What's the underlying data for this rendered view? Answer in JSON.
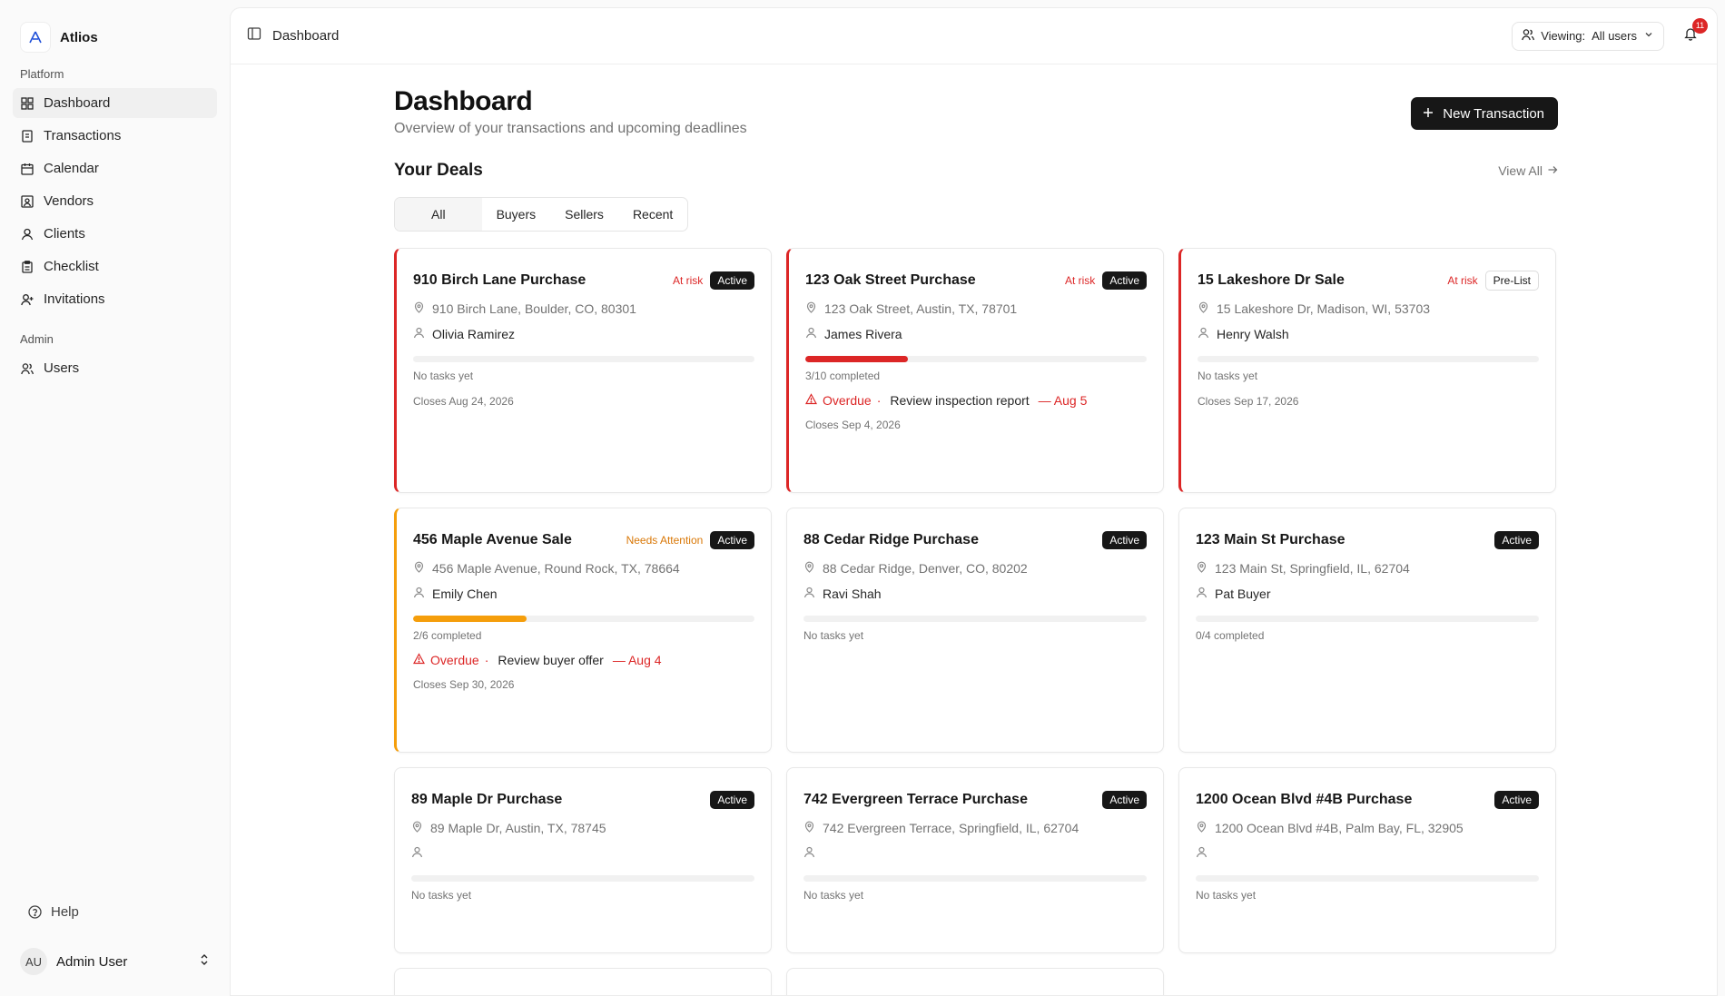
{
  "brand": {
    "name": "Atlios"
  },
  "sidebar": {
    "platform_label": "Platform",
    "items": [
      {
        "label": "Dashboard",
        "icon": "grid-icon"
      },
      {
        "label": "Transactions",
        "icon": "receipt-icon"
      },
      {
        "label": "Calendar",
        "icon": "calendar-icon"
      },
      {
        "label": "Vendors",
        "icon": "vendor-icon"
      },
      {
        "label": "Clients",
        "icon": "user-icon"
      },
      {
        "label": "Checklist",
        "icon": "clipboard-icon"
      },
      {
        "label": "Invitations",
        "icon": "user-plus-icon"
      }
    ],
    "admin_label": "Admin",
    "admin_items": [
      {
        "label": "Users",
        "icon": "users-icon"
      }
    ],
    "help_label": "Help",
    "user": {
      "initials": "AU",
      "name": "Admin User"
    }
  },
  "topbar": {
    "breadcrumb": "Dashboard",
    "viewing_label": "Viewing:",
    "viewing_value": "All users",
    "notification_count": "11"
  },
  "page": {
    "title": "Dashboard",
    "subtitle": "Overview of your transactions and upcoming deadlines",
    "new_button": "New Transaction",
    "deals_title": "Your Deals",
    "view_all": "View All"
  },
  "tabs": [
    "All",
    "Buyers",
    "Sellers",
    "Recent"
  ],
  "colors": {
    "risk": "#dc2626",
    "attention": "#f59e0b",
    "primary": "#171717"
  },
  "deals": [
    {
      "title": "910 Birch Lane Purchase",
      "flag": "At risk",
      "status": "Active",
      "address": "910 Birch Lane, Boulder, CO, 80301",
      "client": "Olivia Ramirez",
      "progress_text": "No tasks yet",
      "progress": 0,
      "closes": "Closes Aug 24, 2026"
    },
    {
      "title": "123 Oak Street Purchase",
      "flag": "At risk",
      "status": "Active",
      "address": "123 Oak Street, Austin, TX, 78701",
      "client": "James Rivera",
      "progress_text": "3/10 completed",
      "progress": 0.3,
      "overdue_label": "Overdue",
      "overdue_task": "Review inspection report",
      "overdue_date": "— Aug 5",
      "closes": "Closes Sep 4, 2026"
    },
    {
      "title": "15 Lakeshore Dr Sale",
      "flag": "At risk",
      "status": "Pre-List",
      "address": "15 Lakeshore Dr, Madison, WI, 53703",
      "client": "Henry Walsh",
      "progress_text": "No tasks yet",
      "progress": 0,
      "closes": "Closes Sep 17, 2026"
    },
    {
      "title": "456 Maple Avenue Sale",
      "flag": "Needs Attention",
      "status": "Active",
      "address": "456 Maple Avenue, Round Rock, TX, 78664",
      "client": "Emily Chen",
      "progress_text": "2/6 completed",
      "progress": 0.333,
      "overdue_label": "Overdue",
      "overdue_task": "Review buyer offer",
      "overdue_date": "— Aug 4",
      "closes": "Closes Sep 30, 2026"
    },
    {
      "title": "88 Cedar Ridge Purchase",
      "status": "Active",
      "address": "88 Cedar Ridge, Denver, CO, 80202",
      "client": "Ravi Shah",
      "progress_text": "No tasks yet",
      "progress": 0
    },
    {
      "title": "123 Main St Purchase",
      "status": "Active",
      "address": "123 Main St, Springfield, IL, 62704",
      "client": "Pat Buyer",
      "progress_text": "0/4 completed",
      "progress": 0
    },
    {
      "title": "89 Maple Dr Purchase",
      "status": "Active",
      "address": "89 Maple Dr, Austin, TX, 78745",
      "client": "",
      "progress_text": "No tasks yet",
      "progress": 0
    },
    {
      "title": "742 Evergreen Terrace Purchase",
      "status": "Active",
      "address": "742 Evergreen Terrace, Springfield, IL, 62704",
      "client": "",
      "progress_text": "No tasks yet",
      "progress": 0
    },
    {
      "title": "1200 Ocean Blvd #4B Purchase",
      "status": "Active",
      "address": "1200 Ocean Blvd #4B, Palm Bay, FL, 32905",
      "client": "",
      "progress_text": "No tasks yet",
      "progress": 0
    }
  ]
}
